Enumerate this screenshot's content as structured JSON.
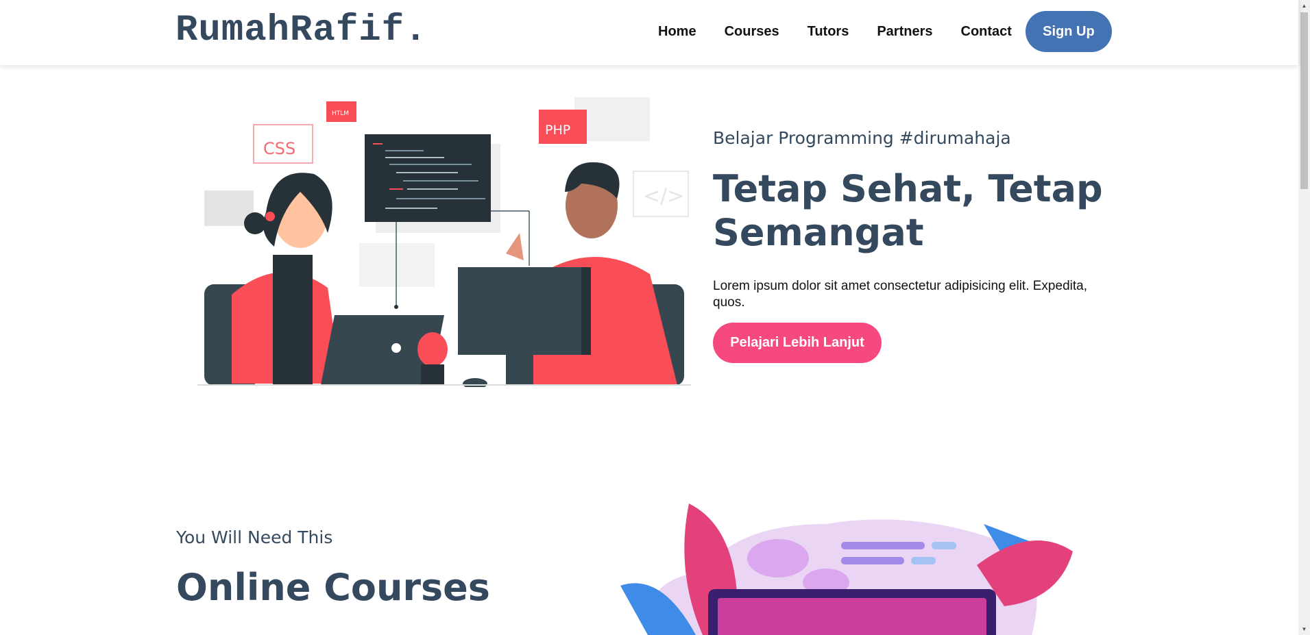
{
  "brand": {
    "name": "RumahRafif."
  },
  "nav": {
    "links": [
      "Home",
      "Courses",
      "Tutors",
      "Partners",
      "Contact"
    ],
    "signup_label": "Sign Up"
  },
  "hero": {
    "subtitle": "Belajar Programming #dirumahaja",
    "title": "Tetap Sehat, Tetap Semangat",
    "description": "Lorem ipsum dolor sit amet consectetur adipisicing elit. Expedita, quos.",
    "cta_label": "Pelajari Lebih Lanjut",
    "illustration_labels": {
      "css": "CSS",
      "html": "HTLM",
      "php": "PHP"
    }
  },
  "courses": {
    "subtitle": "You Will Need This",
    "title": "Online Courses"
  },
  "colors": {
    "primary_text": "#34495e",
    "signup_button": "#4473b4",
    "cta_button": "#f5497f",
    "accent_red": "#f94d57",
    "dark_teal": "#37474f"
  }
}
